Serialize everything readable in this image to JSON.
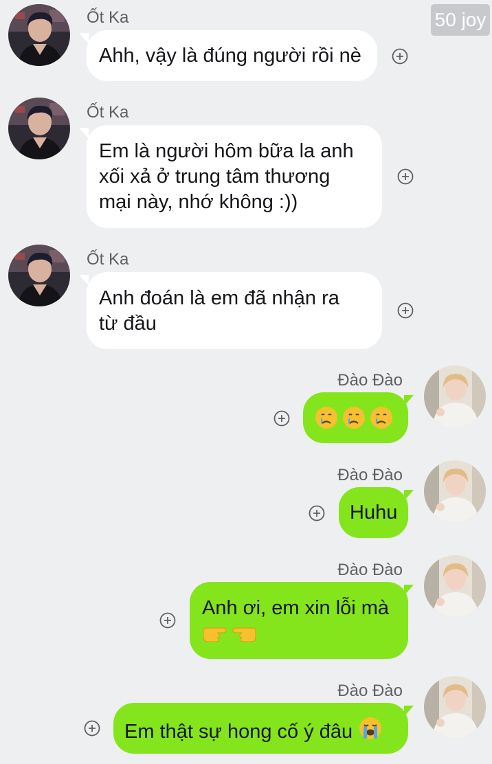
{
  "badge": {
    "label": "50 joy"
  },
  "messages": [
    {
      "sender": "Ốt Ka",
      "direction": "incoming",
      "text": "Ahh, vậy là đúng người rồi nè"
    },
    {
      "sender": "Ốt Ka",
      "direction": "incoming",
      "text": "Em là người hôm bữa la anh\nxối xả ở trung tâm thương\nmại này, nhớ không :))"
    },
    {
      "sender": "Ốt Ka",
      "direction": "incoming",
      "text": "Anh đoán là em đã nhận ra\ntừ đầu"
    },
    {
      "sender": "Đào Đào",
      "direction": "outgoing",
      "emojis": [
        "crying-face-icon",
        "crying-face-icon",
        "crying-face-icon"
      ]
    },
    {
      "sender": "Đào Đào",
      "direction": "outgoing",
      "text": "Huhu"
    },
    {
      "sender": "Đào Đào",
      "direction": "outgoing",
      "text": "Anh ơi, em xin lỗi mà",
      "emojis": [
        "pointing-right-hand-icon",
        "pointing-left-hand-icon"
      ]
    },
    {
      "sender": "Đào Đào",
      "direction": "outgoing",
      "text": "Em thật sự hong cố ý đâu",
      "emojis": [
        "loudly-crying-face-icon"
      ]
    }
  ],
  "colors": {
    "background": "#eeeff1",
    "incoming_bubble": "#ffffff",
    "outgoing_bubble": "#84e51c",
    "sender_name": "#5f5f62",
    "badge": "#c8c9cc"
  }
}
